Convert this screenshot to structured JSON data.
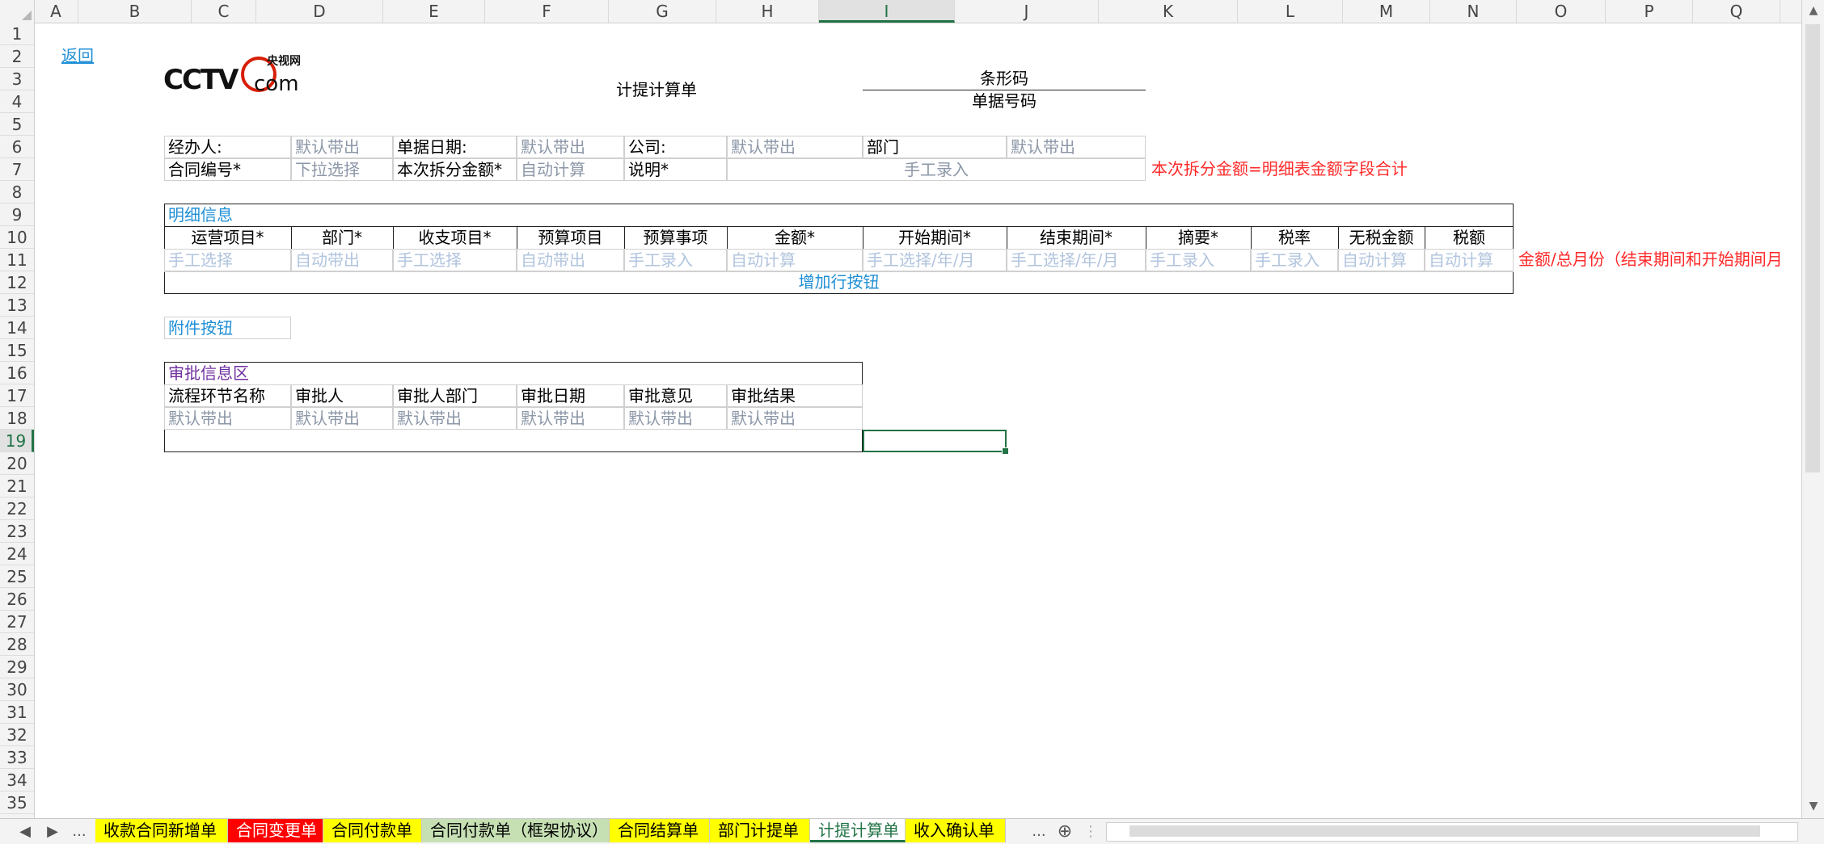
{
  "columns": [
    "A",
    "B",
    "C",
    "D",
    "E",
    "F",
    "G",
    "H",
    "I",
    "J",
    "K",
    "L",
    "M",
    "N",
    "O",
    "P",
    "Q"
  ],
  "selected_column": "I",
  "rows": [
    "1",
    "2",
    "3",
    "4",
    "5",
    "6",
    "7",
    "8",
    "9",
    "10",
    "11",
    "12",
    "13",
    "14",
    "15",
    "16",
    "17",
    "18",
    "19",
    "20",
    "21",
    "22",
    "23",
    "24",
    "25",
    "26",
    "27",
    "28",
    "29",
    "30",
    "31",
    "32",
    "33",
    "34",
    "35"
  ],
  "selected_row": "19",
  "colors": {
    "excel_green": "#217346",
    "red_note": "#ff2a2a",
    "blue_section": "#1f8fd6",
    "purple_section": "#7030a0",
    "placeholder_gray": "#8c97a7"
  },
  "sheet": {
    "back_link": "返回",
    "logo_text": "CCTV.com 央视网",
    "title": "计提计算单",
    "barcode_label": "条形码",
    "doc_number_label": "单据号码",
    "row6": [
      "经办人:",
      "默认带出",
      "单据日期:",
      "默认带出",
      "公司:",
      "默认带出",
      "部门",
      "默认带出"
    ],
    "row7": [
      "合同编号*",
      "下拉选择",
      "本次拆分金额*",
      "自动计算",
      "说明*",
      "手工录入"
    ],
    "row7_note": "本次拆分金额=明细表金额字段合计",
    "detail": {
      "title": "明细信息",
      "headers": [
        "运营项目*",
        "部门*",
        "收支项目*",
        "预算项目",
        "预算事项",
        "金额*",
        "开始期间*",
        "结束期间*",
        "摘要*",
        "税率",
        "无税金额",
        "税额"
      ],
      "placeholders": [
        "手工选择",
        "自动带出",
        "手工选择",
        "自动带出",
        "手工录入",
        "自动计算",
        "手工选择/年/月",
        "手工选择/年/月",
        "手工录入",
        "手工录入",
        "自动计算",
        "自动计算"
      ],
      "note": "金额/总月份（结束期间和开始期间月",
      "add_row_button": "增加行按钮"
    },
    "attachment_button": "附件按钮",
    "approval": {
      "title": "审批信息区",
      "headers": [
        "流程环节名称",
        "审批人",
        "审批人部门",
        "审批日期",
        "审批意见",
        "审批结果"
      ],
      "values": [
        "默认带出",
        "默认带出",
        "默认带出",
        "默认带出",
        "默认带出",
        "默认带出"
      ]
    }
  },
  "tabs": {
    "nav_prev": "◀",
    "nav_next": "▶",
    "ellipsis_left": "...",
    "ellipsis_right": "...",
    "items": [
      {
        "label": "收款合同新增单",
        "color": "#ffff00"
      },
      {
        "label": "合同变更单",
        "color": "#ff0000"
      },
      {
        "label": "合同付款单",
        "color": "#ffff00"
      },
      {
        "label": "合同付款单（框架协议）",
        "color": "#c6e0b4"
      },
      {
        "label": "合同结算单",
        "color": "#ffff00"
      },
      {
        "label": "部门计提单",
        "color": "#ffff00"
      },
      {
        "label": "计提计算单",
        "color": "#ffffff"
      },
      {
        "label": "收入确认单",
        "color": "#ffff00"
      }
    ],
    "active": "计提计算单",
    "add_sheet": "⊕"
  }
}
